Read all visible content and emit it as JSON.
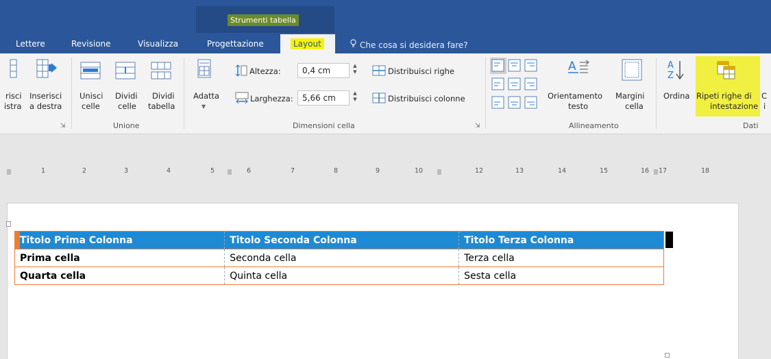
{
  "contextual_tab": "Strumenti tabella",
  "tabs": [
    "Lettere",
    "Revisione",
    "Visualizza",
    "Progettazione",
    "Layout"
  ],
  "tell_me": "Che cosa si desidera fare?",
  "ribbon": {
    "insert_left_line1": "risci",
    "insert_left_line2": "istra",
    "insert_right_line1": "Inserisci",
    "insert_right_line2": "a destra",
    "merge_line1": "Unisci",
    "merge_line2": "celle",
    "split_cells_line1": "Dividi",
    "split_cells_line2": "celle",
    "split_table_line1": "Dividi",
    "split_table_line2": "tabella",
    "group_merge": "Unione",
    "autofit": "Adatta",
    "height_label": "Altezza:",
    "height_value": "0,4 cm",
    "width_label": "Larghezza:",
    "width_value": "5,66 cm",
    "distribute_rows": "Distribuisci righe",
    "distribute_cols": "Distribuisci colonne",
    "group_cell_size": "Dimensioni cella",
    "text_direction_line1": "Orientamento",
    "text_direction_line2": "testo",
    "cell_margins_line1": "Margini",
    "cell_margins_line2": "cella",
    "group_alignment": "Allineamento",
    "sort": "Ordina",
    "repeat_header_line1": "Ripeti righe di",
    "repeat_header_line2": "intestazione",
    "convert_line1": "C",
    "convert_line2": "i",
    "group_data": "Dati",
    "accent_color": "#2b579a",
    "highlight_color": "#f1ef40"
  },
  "ruler": {
    "numbers": [
      "1",
      "2",
      "3",
      "4",
      "5",
      "6",
      "7",
      "8",
      "9",
      "10",
      "12",
      "13",
      "14",
      "15",
      "16",
      "17",
      "18"
    ]
  },
  "table": {
    "headers": [
      "Titolo Prima Colonna",
      "Titolo Seconda Colonna",
      "Titolo Terza Colonna"
    ],
    "rows": [
      [
        "Prima cella",
        "Seconda cella",
        "Terza cella"
      ],
      [
        "Quarta cella",
        "Quinta cella",
        "Sesta cella"
      ]
    ],
    "header_color": "#1e8ad4",
    "border_color": "#ed7d31"
  }
}
